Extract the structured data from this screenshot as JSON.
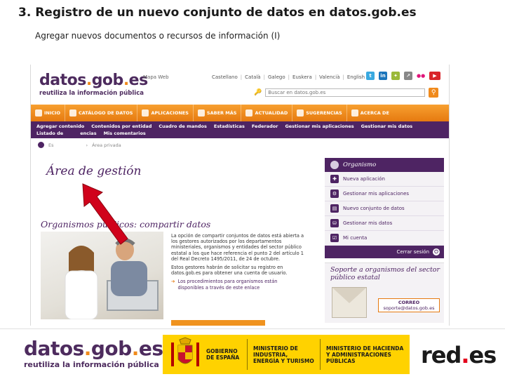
{
  "slide": {
    "title": "3. Registro de un nuevo conjunto de datos en datos.gob.es",
    "subtitle": "Agregar nuevos documentos o recursos de información (I)"
  },
  "site": {
    "logo_main": "datos.gob.es",
    "logo_tagline": "reutiliza la información pública",
    "mapa_web": "Mapa Web",
    "languages": [
      "Castellano",
      "Català",
      "Galego",
      "Euskera",
      "Valencià",
      "English"
    ],
    "search_placeholder": "Buscar en datos.gob.es",
    "search_button_icon": "magnifier-icon",
    "main_nav": [
      {
        "label": "INICIO",
        "icon": "home-icon"
      },
      {
        "label": "CATÁLOGO DE DATOS",
        "icon": "catalog-icon"
      },
      {
        "label": "APLICACIONES",
        "icon": "gear-icon"
      },
      {
        "label": "SABER MÁS",
        "icon": "tools-icon"
      },
      {
        "label": "ACTUALIDAD",
        "icon": "news-icon"
      },
      {
        "label": "SUGERENCIAS",
        "icon": "chat-icon"
      },
      {
        "label": "ACERCA DE",
        "icon": "person-icon"
      }
    ],
    "sub_nav_row1": [
      "Agregar contenido",
      "Contenidos por entidad",
      "Cuadro de mandos",
      "Estadísticas",
      "Federador",
      "Gestionar mis aplicaciones",
      "Gestionar mis datos"
    ],
    "sub_nav_row2": [
      "Listado de",
      "encias",
      "Mis comentarios"
    ],
    "breadcrumb": [
      "Es",
      "Área privada"
    ],
    "page_title": "Área de gestión",
    "section_title": "Organismos públicos: compartir datos",
    "desc_p1": "La opción de compartir conjuntos de datos está abierta a los gestores autorizados por los departamentos ministeriales, organismos y entidades del sector público estatal a los que hace referencia el punto 2 del artículo 1 del Real Decreto 1495/2011, de 24 de octubre.",
    "desc_p2": "Estos gestores habrán de solicitar su registro en datos.gob.es para obtener una cuenta de usuario.",
    "desc_link": "Los procedimientos para organismos están disponibles a través de este enlace",
    "panel": {
      "title": "Organismo",
      "items": [
        {
          "label": "Nueva aplicación",
          "icon": "new-app-icon"
        },
        {
          "label": "Gestionar mis aplicaciones",
          "icon": "manage-apps-icon"
        },
        {
          "label": "Nuevo conjunto de datos",
          "icon": "new-dataset-icon"
        },
        {
          "label": "Gestionar mis datos",
          "icon": "manage-data-icon"
        },
        {
          "label": "Mi cuenta",
          "icon": "account-icon"
        }
      ],
      "logout": "Cerrar sesión"
    },
    "support": {
      "title": "Soporte a organismos del sector público estatal",
      "mail_label": "CORREO",
      "mail_address": "soporte@datos.gob.es"
    }
  },
  "footer": {
    "logo_main": "datos.gob.es",
    "logo_tagline": "reutiliza la información pública",
    "gov": "GOBIERNO DE ESPAÑA",
    "ministry1": "MINISTERIO DE INDUSTRIA, ENERGÍA Y TURISMO",
    "ministry2": "MINISTERIO DE HACIENDA Y ADMINISTRACIONES PÚBLICAS",
    "redes": "red.es"
  },
  "colors": {
    "brand_purple": "#4e2463",
    "brand_orange": "#f08a1c",
    "arrow_red": "#d0021b",
    "gov_yellow": "#ffd200"
  }
}
